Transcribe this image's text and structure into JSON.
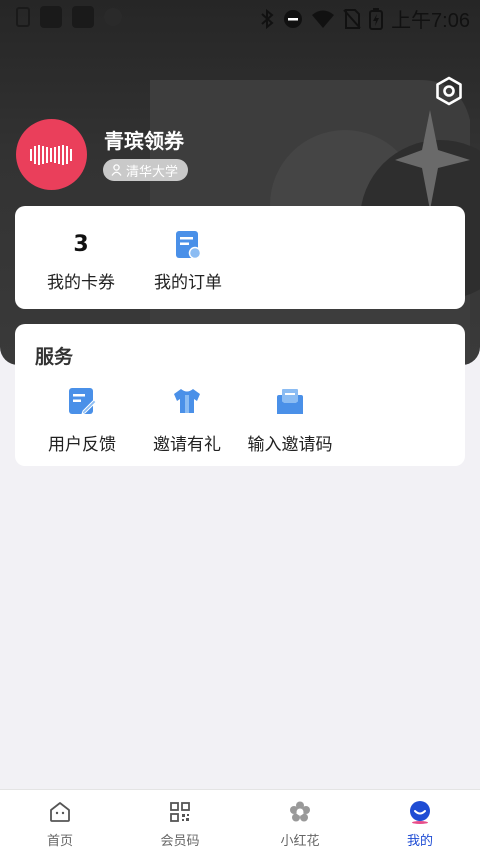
{
  "status_bar": {
    "time": "上午7:06"
  },
  "profile": {
    "name": "青瑸领券",
    "school": "清华大学"
  },
  "stats": [
    {
      "value": "3",
      "label": "我的卡券"
    },
    {
      "value": "",
      "label": "我的订单"
    }
  ],
  "services": {
    "title": "服务",
    "items": [
      {
        "label": "用户反馈",
        "icon": "feedback-icon"
      },
      {
        "label": "邀请有礼",
        "icon": "gift-shirt-icon"
      },
      {
        "label": "输入邀请码",
        "icon": "invite-envelope-icon"
      }
    ]
  },
  "nav": {
    "items": [
      {
        "label": "首页",
        "icon": "home-icon"
      },
      {
        "label": "会员码",
        "icon": "qr-code-icon"
      },
      {
        "label": "小红花",
        "icon": "flower-icon"
      },
      {
        "label": "我的",
        "icon": "profile-icon"
      }
    ],
    "active_index": 3
  },
  "colors": {
    "accent": "#1e4cd4",
    "avatar": "#ea3f5b",
    "icon_blue": "#4a90e8"
  }
}
